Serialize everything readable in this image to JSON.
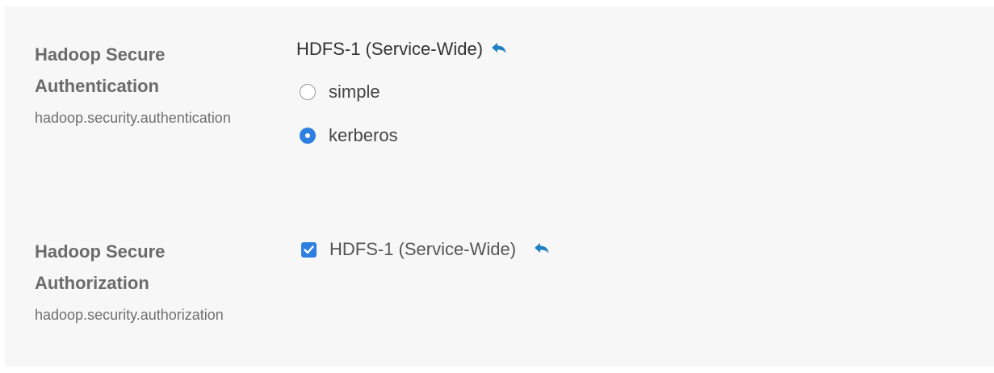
{
  "settings": [
    {
      "title": "Hadoop Secure Authentication",
      "key": "hadoop.security.authentication",
      "scope": "HDFS-1 (Service-Wide)",
      "options": [
        {
          "label": "simple",
          "selected": false
        },
        {
          "label": "kerberos",
          "selected": true
        }
      ]
    },
    {
      "title": "Hadoop Secure Authorization",
      "key": "hadoop.security.authorization",
      "checkbox_label": "HDFS-1 (Service-Wide)",
      "checked": true
    }
  ],
  "colors": {
    "accent": "#2d7fe0",
    "undo_icon": "#1f7fc2",
    "panel_bg": "#f7f7f7"
  },
  "icons": {
    "undo": "undo-icon"
  }
}
